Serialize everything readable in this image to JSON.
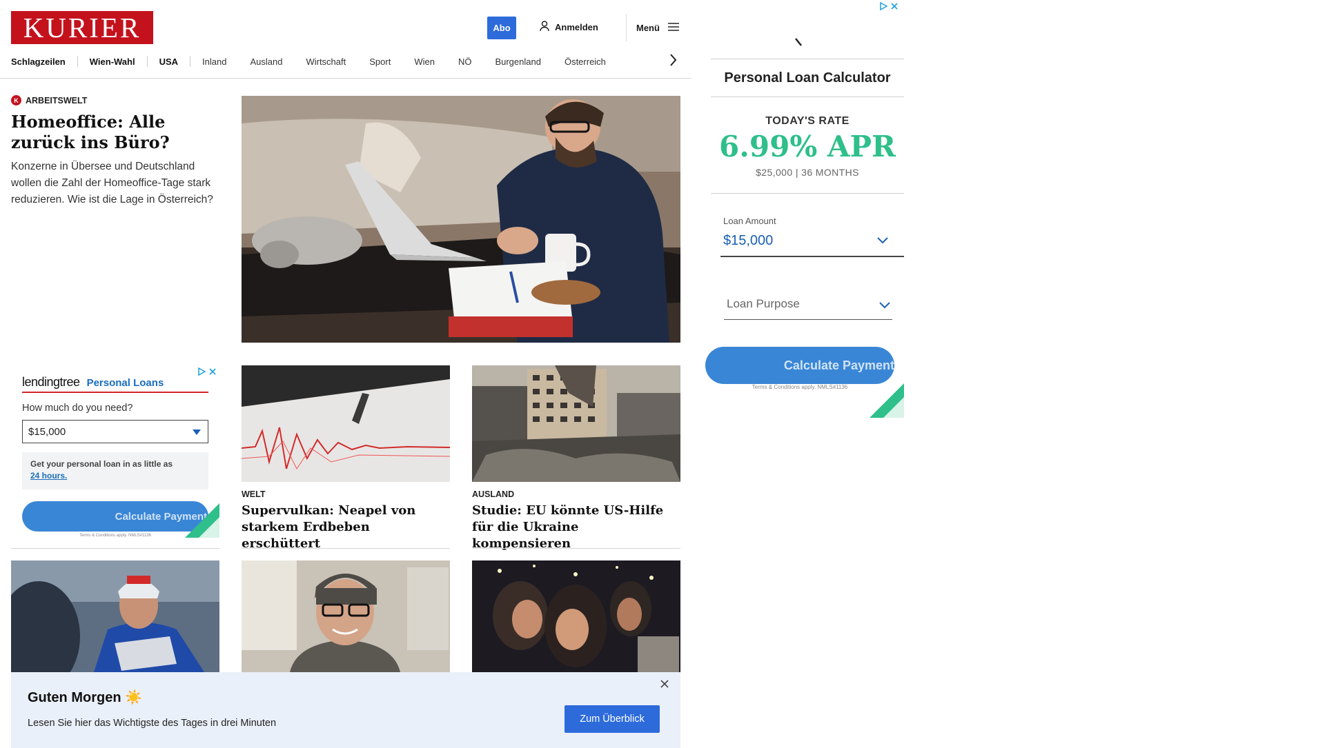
{
  "header": {
    "logo_text": "KURIER",
    "abo_label": "Abo",
    "login_label": "Anmelden",
    "menu_label": "Menü"
  },
  "nav": {
    "items": [
      "Schlagzeilen",
      "Wien-Wahl",
      "USA",
      "Inland",
      "Ausland",
      "Wirtschaft",
      "Sport",
      "Wien",
      "NÖ",
      "Burgenland",
      "Österreich"
    ]
  },
  "lead": {
    "kicker": "ARBEITSWELT",
    "kicker_icon": "K",
    "title": "Homeoffice: Alle zurück ins Büro?",
    "teaser": "Konzerne in Übersee und Deutschland wollen die Zahl der Homeoffice-Tage stark reduzieren. Wie ist die Lage in Österreich?"
  },
  "cards": [
    {
      "kicker": "WELT",
      "title": "Supervulkan: Neapel von starkem Erdbeben erschüttert"
    },
    {
      "kicker": "AUSLAND",
      "title": "Studie: EU könnte US-Hilfe für die Ukraine kompensieren"
    }
  ],
  "left_ad": {
    "brand": "lendingtree",
    "product": "Personal Loans",
    "question": "How much do you need?",
    "amount": "$15,000",
    "info_text": "Get your personal loan in as little as",
    "info_link": "24 hours.",
    "button": "Calculate Payment",
    "terms": "Terms & Conditions apply. NMLS#1136"
  },
  "right_ad": {
    "title": "Personal Loan Calculator",
    "today": "TODAY'S RATE",
    "rate": "6.99% APR",
    "terms": "$25,000 | 36 MONTHS",
    "loan_label": "Loan Amount",
    "loan_value": "$15,000",
    "purpose": "Loan Purpose",
    "button": "Calculate Payment",
    "fine_print": "Terms & Conditions apply. NMLS#1136"
  },
  "banner": {
    "title": "Guten Morgen ☀️",
    "text": "Lesen Sie hier das Wichtigste des Tages in drei Minuten",
    "button": "Zum Überblick"
  },
  "colors": {
    "brand_red": "#c4121d",
    "accent_blue": "#2d6bdb",
    "rate_green": "#2fbf8a",
    "banner_bg": "#eaf0f9"
  }
}
